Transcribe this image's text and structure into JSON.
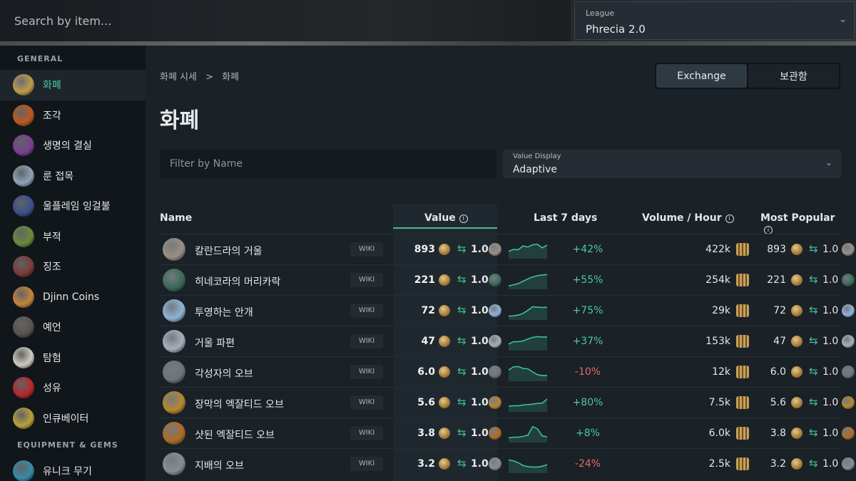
{
  "search": {
    "placeholder": "Search by item..."
  },
  "league": {
    "label": "League",
    "value": "Phrecia 2.0"
  },
  "sidebar": {
    "general_heading": "GENERAL",
    "equipment_heading": "EQUIPMENT & GEMS",
    "items": [
      {
        "label": "화폐",
        "icon": "currency-icon",
        "color": "#c19a4b"
      },
      {
        "label": "조각",
        "icon": "fragment-icon",
        "color": "#c0571f"
      },
      {
        "label": "생명의 결실",
        "icon": "lifeforce-icon",
        "color": "#7b3f8f"
      },
      {
        "label": "룬 접목",
        "icon": "rune-graft-icon",
        "color": "#8fa3b8"
      },
      {
        "label": "울플레임 잉걸불",
        "icon": "ember-icon",
        "color": "#3d4f8a"
      },
      {
        "label": "부적",
        "icon": "amulet-icon",
        "color": "#6b8a3a"
      },
      {
        "label": "징조",
        "icon": "omen-icon",
        "color": "#7a3a3a"
      },
      {
        "label": "Djinn Coins",
        "icon": "djinn-coin-icon",
        "color": "#c4853c"
      },
      {
        "label": "예언",
        "icon": "prophecy-icon",
        "color": "#5a5350"
      },
      {
        "label": "탐험",
        "icon": "expedition-icon",
        "color": "#cfcac0"
      },
      {
        "label": "성유",
        "icon": "oil-icon",
        "color": "#b8282a"
      },
      {
        "label": "인큐베이터",
        "icon": "incubator-icon",
        "color": "#b8a13a"
      }
    ],
    "equipment_items": [
      {
        "label": "유니크 무기",
        "icon": "unique-weapon-icon",
        "color": "#3a8aa8"
      }
    ]
  },
  "breadcrumb": {
    "root": "화폐 시세",
    "sep": ">",
    "current": "화폐"
  },
  "toggle": {
    "exchange": "Exchange",
    "stash": "보관함"
  },
  "page_title": "화폐",
  "filter": {
    "placeholder": "Filter by Name"
  },
  "value_display": {
    "label": "Value Display",
    "value": "Adaptive"
  },
  "table": {
    "headers": {
      "name": "Name",
      "value": "Value",
      "last7": "Last 7 days",
      "volume": "Volume / Hour",
      "popular": "Most Popular"
    },
    "wiki_label": "WIKI",
    "one_label": "1.0",
    "rows": [
      {
        "name": "칼란드라의 거울",
        "value": "893",
        "change": "+42%",
        "trend": "up",
        "volume": "422k",
        "popular": "893",
        "icon": "mirror-icon",
        "color": "#9a8f84",
        "spark": [
          3,
          3.5,
          3.4,
          4.4,
          4.1,
          4.7,
          4.8,
          3.9,
          4.6
        ]
      },
      {
        "name": "히네코라의 머리카락",
        "value": "221",
        "change": "+55%",
        "trend": "up",
        "volume": "254k",
        "popular": "221",
        "icon": "hair-icon",
        "color": "#3a6a58",
        "spark": [
          2,
          2.3,
          2.6,
          3.2,
          3.8,
          4.3,
          4.6,
          4.8,
          4.9
        ]
      },
      {
        "name": "투영하는 안개",
        "value": "72",
        "change": "+75%",
        "trend": "up",
        "volume": "29k",
        "popular": "72",
        "icon": "mist-icon",
        "color": "#8fb3d6",
        "spark": [
          2.1,
          2.2,
          2.4,
          2.8,
          3.6,
          4.5,
          4.4,
          4.3,
          4.4
        ]
      },
      {
        "name": "거울 파편",
        "value": "47",
        "change": "+37%",
        "trend": "up",
        "volume": "153k",
        "popular": "47",
        "icon": "mirror-shard-icon",
        "color": "#a6b0ba",
        "spark": [
          2.8,
          3.4,
          3.4,
          3.6,
          4.1,
          4.5,
          4.7,
          4.6,
          4.6
        ]
      },
      {
        "name": "각성자의 오브",
        "value": "6.0",
        "change": "-10%",
        "trend": "down",
        "volume": "12k",
        "popular": "6.0",
        "icon": "awakener-orb-icon",
        "color": "#6e747a",
        "spark": [
          4,
          4.8,
          4.9,
          4.4,
          4.3,
          3.5,
          2.8,
          2.6,
          2.6
        ]
      },
      {
        "name": "장막의 엑잘티드 오브",
        "value": "5.6",
        "change": "+80%",
        "trend": "up",
        "volume": "7.5k",
        "popular": "5.6",
        "icon": "veiled-exalt-icon",
        "color": "#b8862e",
        "spark": [
          2.6,
          2.7,
          2.7,
          2.9,
          3,
          3.1,
          3.3,
          3.4,
          4.4
        ]
      },
      {
        "name": "샷된 엑잘티드 오브",
        "value": "3.8",
        "change": "+8%",
        "trend": "up",
        "volume": "6.0k",
        "popular": "3.8",
        "icon": "eldritch-exalt-icon",
        "color": "#b06b24",
        "spark": [
          2.3,
          2.5,
          2.5,
          2.7,
          3,
          5.2,
          4.6,
          2.8,
          2.6
        ]
      },
      {
        "name": "지배의 오브",
        "value": "3.2",
        "change": "-24%",
        "trend": "down",
        "volume": "2.5k",
        "popular": "3.2",
        "icon": "dominance-orb-icon",
        "color": "#8a8e92",
        "spark": [
          4.5,
          4.3,
          3.8,
          3.1,
          2.8,
          2.7,
          2.7,
          2.9,
          3.3
        ]
      }
    ]
  },
  "colors": {
    "accent": "#3fbf95",
    "positive": "#4ec9a0",
    "negative": "#e56a6a"
  }
}
